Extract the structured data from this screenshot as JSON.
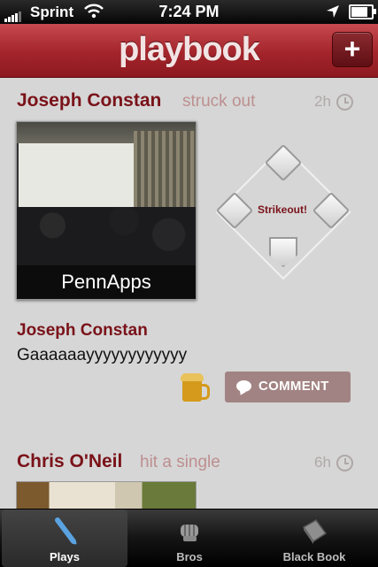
{
  "status_bar": {
    "carrier": "Sprint",
    "time": "7:24 PM",
    "battery_level": 0.8
  },
  "nav": {
    "title": "playbook",
    "add_label": "+"
  },
  "posts": [
    {
      "name": "Joseph Constan",
      "action": "struck out",
      "time_ago": "2h",
      "photo_caption": "PennApps",
      "play_result": "Strikeout!",
      "comment_author": "Joseph Constan",
      "comment_text": "Gaaaaaayyyyyyyyyyyy",
      "comment_button": "COMMENT"
    },
    {
      "name": "Chris O'Neil",
      "action": "hit a single",
      "time_ago": "6h"
    }
  ],
  "tabs": [
    {
      "label": "Plays",
      "icon": "bat-icon",
      "active": true
    },
    {
      "label": "Bros",
      "icon": "fist-icon",
      "active": false
    },
    {
      "label": "Black Book",
      "icon": "book-icon",
      "active": false
    }
  ],
  "colors": {
    "brand": "#a3242b",
    "name": "#7a1219",
    "action": "#bd8f90",
    "comment_button": "#a28383"
  }
}
